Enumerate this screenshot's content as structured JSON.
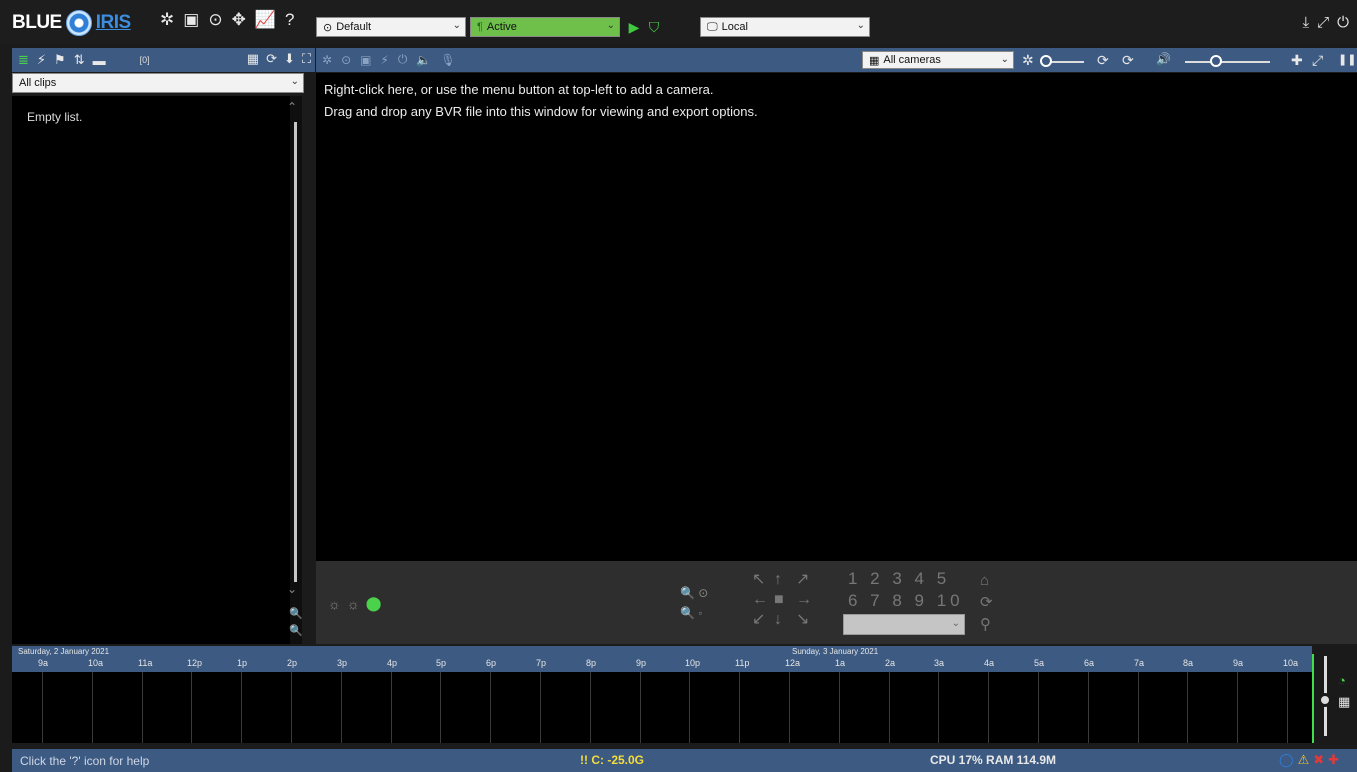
{
  "app": {
    "logo_left": "BLUE",
    "logo_right": "IRIS",
    "top_icons": [
      "gear-icon",
      "film-icon",
      "clock-icon",
      "move-icon",
      "chart-icon",
      "help-icon"
    ],
    "top_icon_glyphs": [
      "✲",
      "▣",
      "⊙",
      "✥",
      "📈",
      "?"
    ],
    "profile_dropdown": "Default",
    "profile_icon": "⊙",
    "schedule_dropdown": "Active",
    "schedule_icon": "¶",
    "play_icon": "▶",
    "shield_icon": "⛉",
    "server_dropdown": "Local",
    "server_icon": "🖵",
    "caret": "⌄",
    "window_icons": [
      "⤓",
      "⤢",
      "⏻"
    ]
  },
  "clips_panel": {
    "toolbar_icons": [
      "≣",
      "⚡",
      "⚑",
      "⇅",
      "▬"
    ],
    "count": "[0]",
    "right_icons": [
      "▦",
      "⟳",
      "⬇",
      "⛶"
    ],
    "filter": "All clips",
    "empty_text": "Empty list.",
    "scroll_up": "⌃",
    "scroll_down": "⌄",
    "zoom_glyph": "🔍"
  },
  "camera_panel": {
    "toolbar_icons": [
      "✲",
      "⊙",
      "▣",
      "⚡",
      "⏻",
      "🔈",
      "🎙"
    ],
    "camera_group": "All cameras",
    "group_icon": "▦",
    "right_icons": [
      "✲",
      "⟳",
      "🔊",
      "✚",
      "⤢",
      "❚❚"
    ],
    "message_line1": "Right-click here, or use the menu button at top-left to add a camera.",
    "message_line2": "Drag and drop any BVR file into this window for viewing and export options."
  },
  "ptz": {
    "sun_icons": [
      "☼",
      "☼",
      "⬤"
    ],
    "zoom_icons": [
      "🔍 ⊙",
      "🔍 ◦"
    ],
    "arrows": [
      "↖",
      "↑",
      "↗",
      "←",
      "■",
      "→",
      "↙",
      "↓",
      "↘"
    ],
    "presets_row1": "1 2 3 4 5",
    "presets_row2": "6 7 8 9 10",
    "side_icons": [
      "⌂",
      "⟳",
      "⚲"
    ]
  },
  "timeline": {
    "date1": "Saturday, 2 January 2021",
    "date2": "Sunday, 3 January 2021",
    "hours": [
      "9a",
      "10a",
      "11a",
      "12p",
      "1p",
      "2p",
      "3p",
      "4p",
      "5p",
      "6p",
      "7p",
      "8p",
      "9p",
      "10p",
      "11p",
      "12a",
      "1a",
      "2a",
      "3a",
      "4a",
      "5a",
      "6a",
      "7a",
      "8a",
      "9a",
      "10a"
    ],
    "side_icons": [
      "◔",
      "▦"
    ]
  },
  "status": {
    "help": "Click the '?' icon for help",
    "disk": "!! C: -25.0G",
    "cpu_ram": "CPU 17% RAM 114.9M",
    "icons": [
      "◯",
      "⚠",
      "✖",
      "✚"
    ],
    "colors": {
      "circle": "#2f7fe0",
      "warning": "#f0c020",
      "error": "#e23a3a",
      "plus": "#e23a3a"
    }
  },
  "colors": {
    "toolbar_blue": "#3c5a82",
    "active_green": "#6fc04b"
  }
}
